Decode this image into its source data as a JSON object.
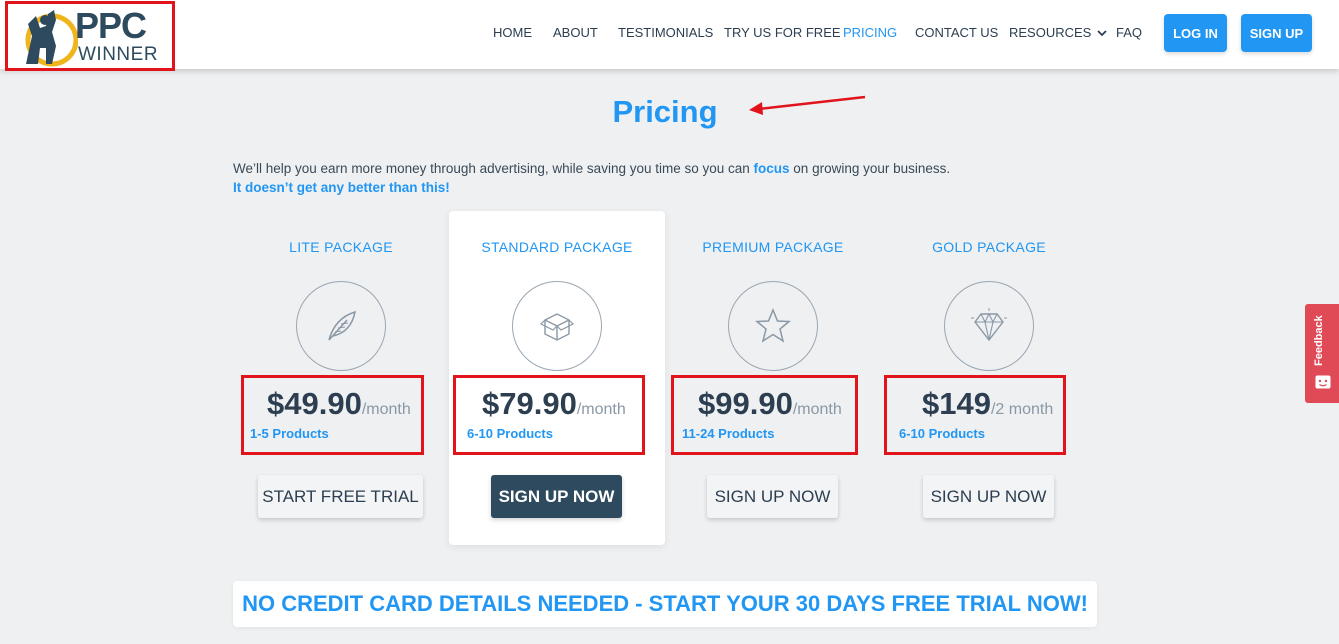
{
  "logo": {
    "line1": "PPC",
    "line2": "WINNER"
  },
  "nav": {
    "items": [
      {
        "label": "HOME"
      },
      {
        "label": "ABOUT"
      },
      {
        "label": "TESTIMONIALS"
      },
      {
        "label": "TRY US FOR FREE"
      },
      {
        "label": "PRICING",
        "active": true
      },
      {
        "label": "CONTACT US"
      },
      {
        "label": "RESOURCES"
      },
      {
        "label": "FAQ"
      }
    ],
    "login_label": "LOG IN",
    "signup_label": "SIGN UP"
  },
  "page": {
    "title": "Pricing",
    "intro_before": "We’ll help you earn more money through advertising, while saving you time so you can ",
    "intro_focus": "focus",
    "intro_after": " on growing your business.",
    "intro_line2": "It doesn’t get any better than this!"
  },
  "packages": [
    {
      "name": "LITE PACKAGE",
      "icon": "feather-icon",
      "price": "$49.90",
      "period": "/month",
      "products": "1-5 Products",
      "button": "START FREE TRIAL"
    },
    {
      "name": "STANDARD PACKAGE",
      "icon": "box-icon",
      "price": "$79.90",
      "period": "/month",
      "products": "6-10 Products",
      "button": "SIGN UP NOW"
    },
    {
      "name": "PREMIUM PACKAGE",
      "icon": "star-icon",
      "price": "$99.90",
      "period": "/month",
      "products": "11-24 Products",
      "button": "SIGN UP NOW"
    },
    {
      "name": "GOLD PACKAGE",
      "icon": "diamond-icon",
      "price": "$149",
      "period": "/2 month",
      "products": "6-10 Products",
      "button": "SIGN UP NOW"
    }
  ],
  "banner": {
    "text": "NO CREDIT CARD DETAILS NEEDED - START YOUR 30 DAYS FREE TRIAL NOW!"
  },
  "feedback": {
    "label": "Feedback"
  },
  "colors": {
    "accent": "#2196f3",
    "dark": "#2d4a5e",
    "highlight": "#e0141a",
    "feedback": "#e04a57"
  }
}
